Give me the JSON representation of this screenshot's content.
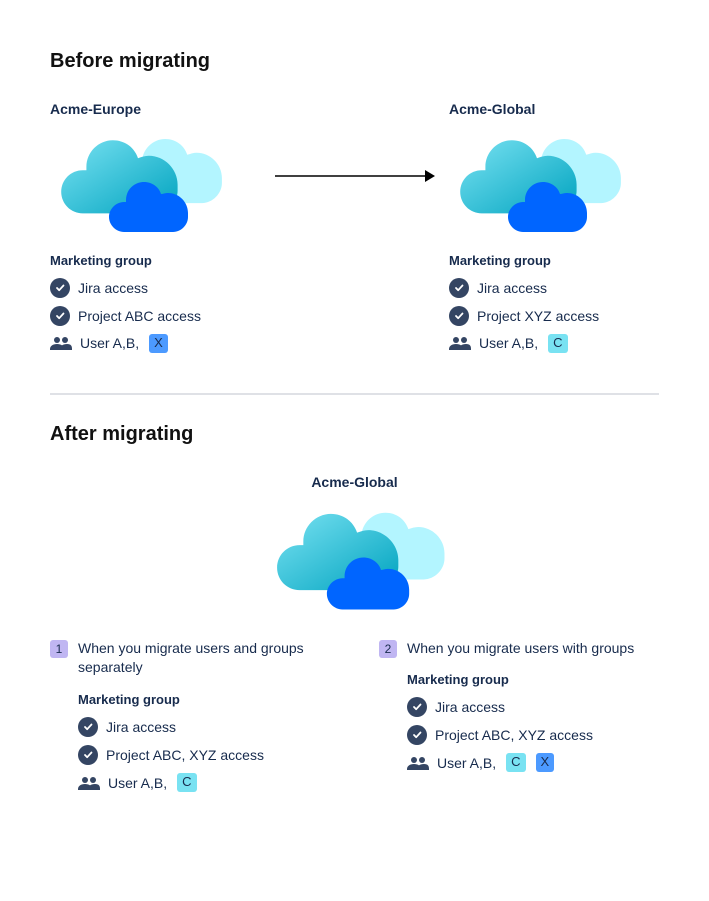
{
  "before": {
    "heading": "Before migrating",
    "left": {
      "site": "Acme-Europe",
      "group": "Marketing group",
      "access1": "Jira access",
      "access2": "Project ABC access",
      "usersPrefix": "User A,B,",
      "tag": "X",
      "tagStyle": "blue"
    },
    "right": {
      "site": "Acme-Global",
      "group": "Marketing group",
      "access1": "Jira access",
      "access2": "Project XYZ access",
      "usersPrefix": "User A,B,",
      "tag": "C",
      "tagStyle": "teal"
    }
  },
  "after": {
    "heading": "After migrating",
    "site": "Acme-Global",
    "scenario1": {
      "num": "1",
      "desc": "When you migrate users and groups separately",
      "group": "Marketing group",
      "access1": "Jira access",
      "access2": "Project ABC, XYZ access",
      "usersPrefix": "User A,B,",
      "tag1": "C"
    },
    "scenario2": {
      "num": "2",
      "desc": "When you migrate users with groups",
      "group": "Marketing group",
      "access1": "Jira access",
      "access2": "Project ABC, XYZ access",
      "usersPrefix": "User A,B,",
      "tag1": "C",
      "tag2": "X"
    }
  }
}
